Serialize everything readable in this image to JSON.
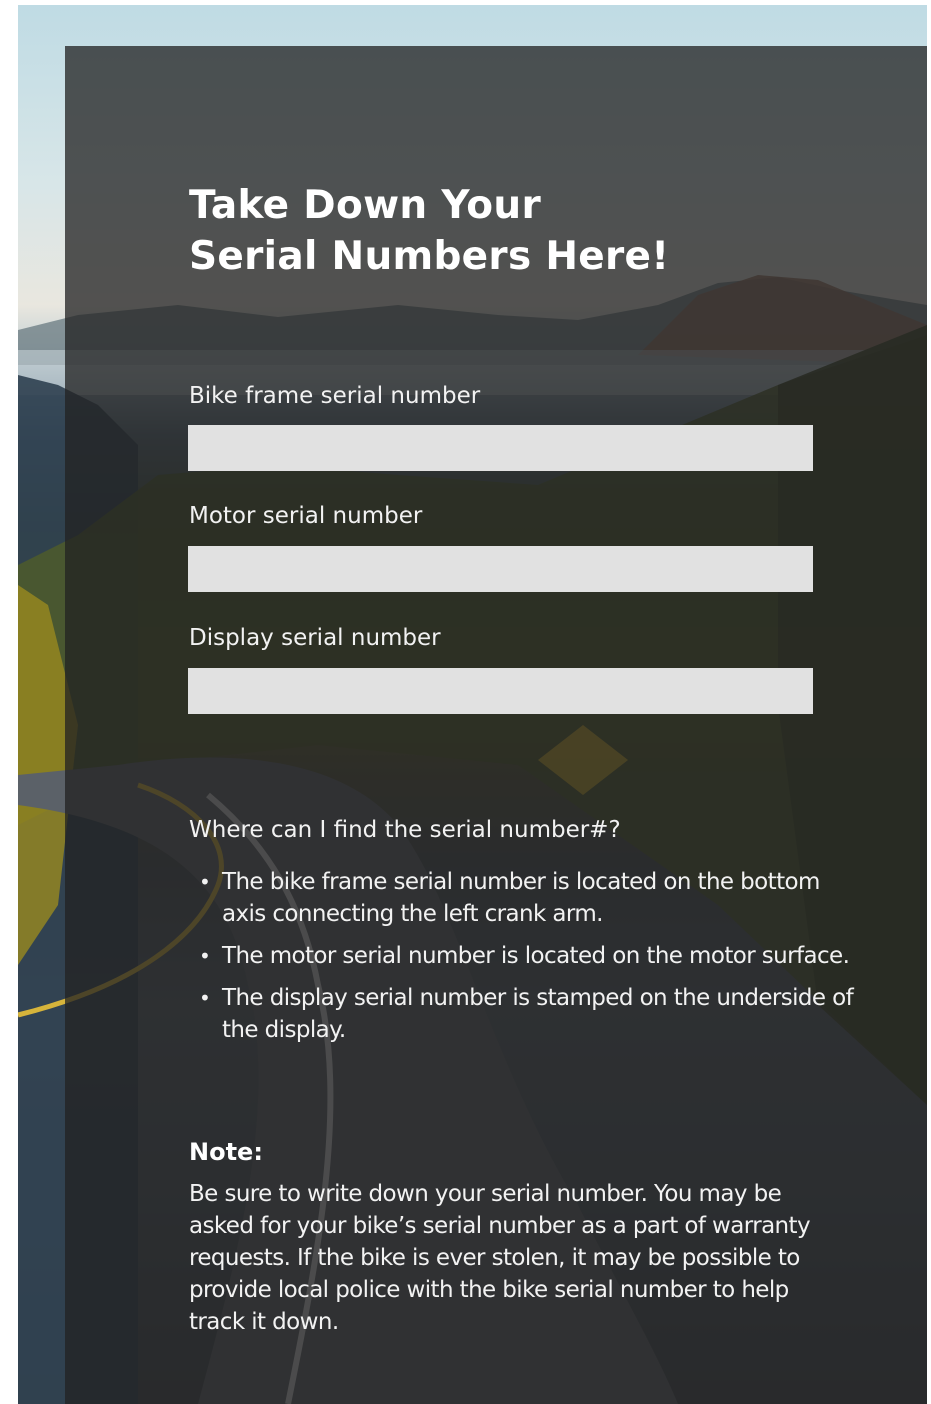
{
  "page": {
    "title_line1": "Take Down Your",
    "title_line2": "Serial Numbers Here!"
  },
  "form": {
    "fields": [
      {
        "label": "Bike frame serial number",
        "value": ""
      },
      {
        "label": "Motor serial number",
        "value": ""
      },
      {
        "label": "Display serial number",
        "value": ""
      }
    ]
  },
  "faq": {
    "heading": "Where can I find the serial number#?",
    "items": [
      "The bike frame serial number is located on the bottom axis connecting the left crank arm.",
      "The motor serial number is located on the motor surface.",
      "The display serial number is stamped on the underside of the display."
    ],
    "bullet": "•"
  },
  "note": {
    "title": "Note:",
    "body": "Be sure to write down your serial number. You may be asked for your bike’s serial number as a part of warranty requests. If the bike is ever stolen, it may be possible to provide local police with the bike serial number to help track it down."
  },
  "colors": {
    "card_overlay": "#222222",
    "input_background": "#e1e1e1",
    "text": "#f2f2f2"
  }
}
